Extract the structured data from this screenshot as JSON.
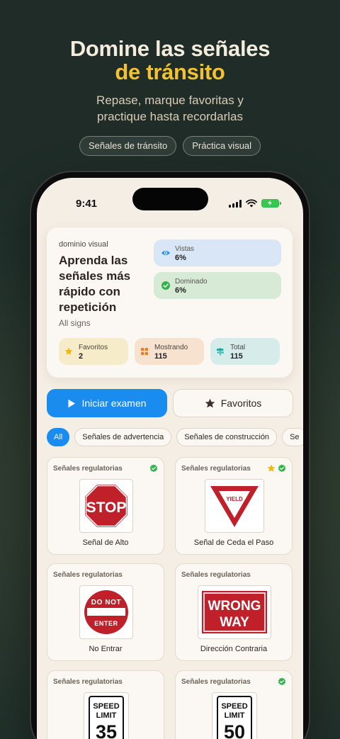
{
  "header": {
    "headline_line1": "Domine las señales",
    "headline_line2": "de tránsito",
    "subtitle_line1": "Repase, marque favoritas y",
    "subtitle_line2": "practique hasta recordarlas",
    "tags": [
      "Señales de tránsito",
      "Práctica visual"
    ]
  },
  "status_bar": {
    "time": "9:41"
  },
  "hero": {
    "eyebrow": "dominio visual",
    "title": "Aprenda las señales más rápido con repetición",
    "subtitle": "All signs",
    "stats": {
      "vistas": {
        "label": "Vistas",
        "value": "6%"
      },
      "dominado": {
        "label": "Dominado",
        "value": "6%"
      }
    },
    "chips": {
      "favoritos": {
        "label": "Favoritos",
        "value": "2"
      },
      "mostrando": {
        "label": "Mostrando",
        "value": "115"
      },
      "total": {
        "label": "Total",
        "value": "115"
      }
    }
  },
  "actions": {
    "start_exam": "Iniciar examen",
    "favorites": "Favoritos"
  },
  "filters": [
    "All",
    "Señales de advertencia",
    "Señales de construcción",
    "Se"
  ],
  "cards": [
    {
      "category": "Señales regulatorias",
      "name": "Señal de Alto",
      "sign_text": "STOP",
      "favorite": false,
      "mastered": true
    },
    {
      "category": "Señales regulatorias",
      "name": "Señal de Ceda el Paso",
      "sign_text": "YIELD",
      "favorite": true,
      "mastered": true
    },
    {
      "category": "Señales regulatorias",
      "name": "No Entrar",
      "sign_text_top": "DO NOT",
      "sign_text_bottom": "ENTER",
      "favorite": false,
      "mastered": false
    },
    {
      "category": "Señales regulatorias",
      "name": "Dirección Contraria",
      "sign_text_top": "WRONG",
      "sign_text_bottom": "WAY",
      "favorite": false,
      "mastered": false
    },
    {
      "category": "Señales regulatorias",
      "sign_line1": "SPEED",
      "sign_line2": "LIMIT",
      "sign_number": "35",
      "favorite": false,
      "mastered": false
    },
    {
      "category": "Señales regulatorias",
      "sign_line1": "SPEED",
      "sign_line2": "LIMIT",
      "sign_number": "50",
      "favorite": false,
      "mastered": true
    }
  ],
  "colors": {
    "accent_blue": "#1a8cf0",
    "headline_yellow": "#f3c232",
    "mastered_green": "#2fb34a",
    "favorite_star": "#f2b705",
    "stop_red": "#c0202a"
  }
}
